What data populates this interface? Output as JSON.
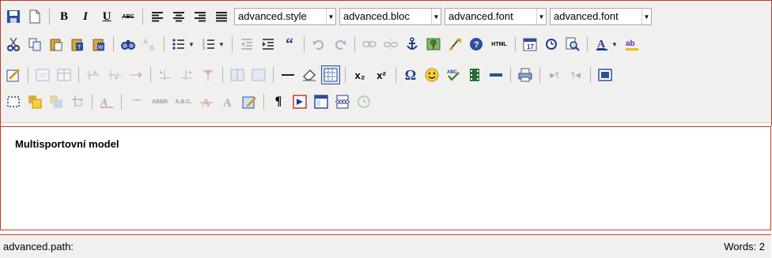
{
  "toolbar": {
    "row1": {
      "bold": "B",
      "italic": "I",
      "underline": "U",
      "strike": "ABC",
      "selects": [
        {
          "value": "advanced.style"
        },
        {
          "value": "advanced.bloc"
        },
        {
          "value": "advanced.font"
        },
        {
          "value": "advanced.font"
        }
      ]
    },
    "row2": {
      "html_label": "HTML"
    },
    "row3": {
      "subscript": "x₂",
      "superscript": "x²",
      "omega": "Ω"
    },
    "row4": {
      "cite": "“””",
      "abbr": "ABBR",
      "acronym": "A.B.C.",
      "pilcrow": "¶"
    }
  },
  "content": {
    "text": "Multisportovní model"
  },
  "statusbar": {
    "path": "advanced.path:",
    "words": "Words: 2"
  },
  "colors": {
    "border": "#c0392b",
    "toolbar_bg": "#f0f0ee",
    "icon_blue": "#1f3a8a"
  }
}
